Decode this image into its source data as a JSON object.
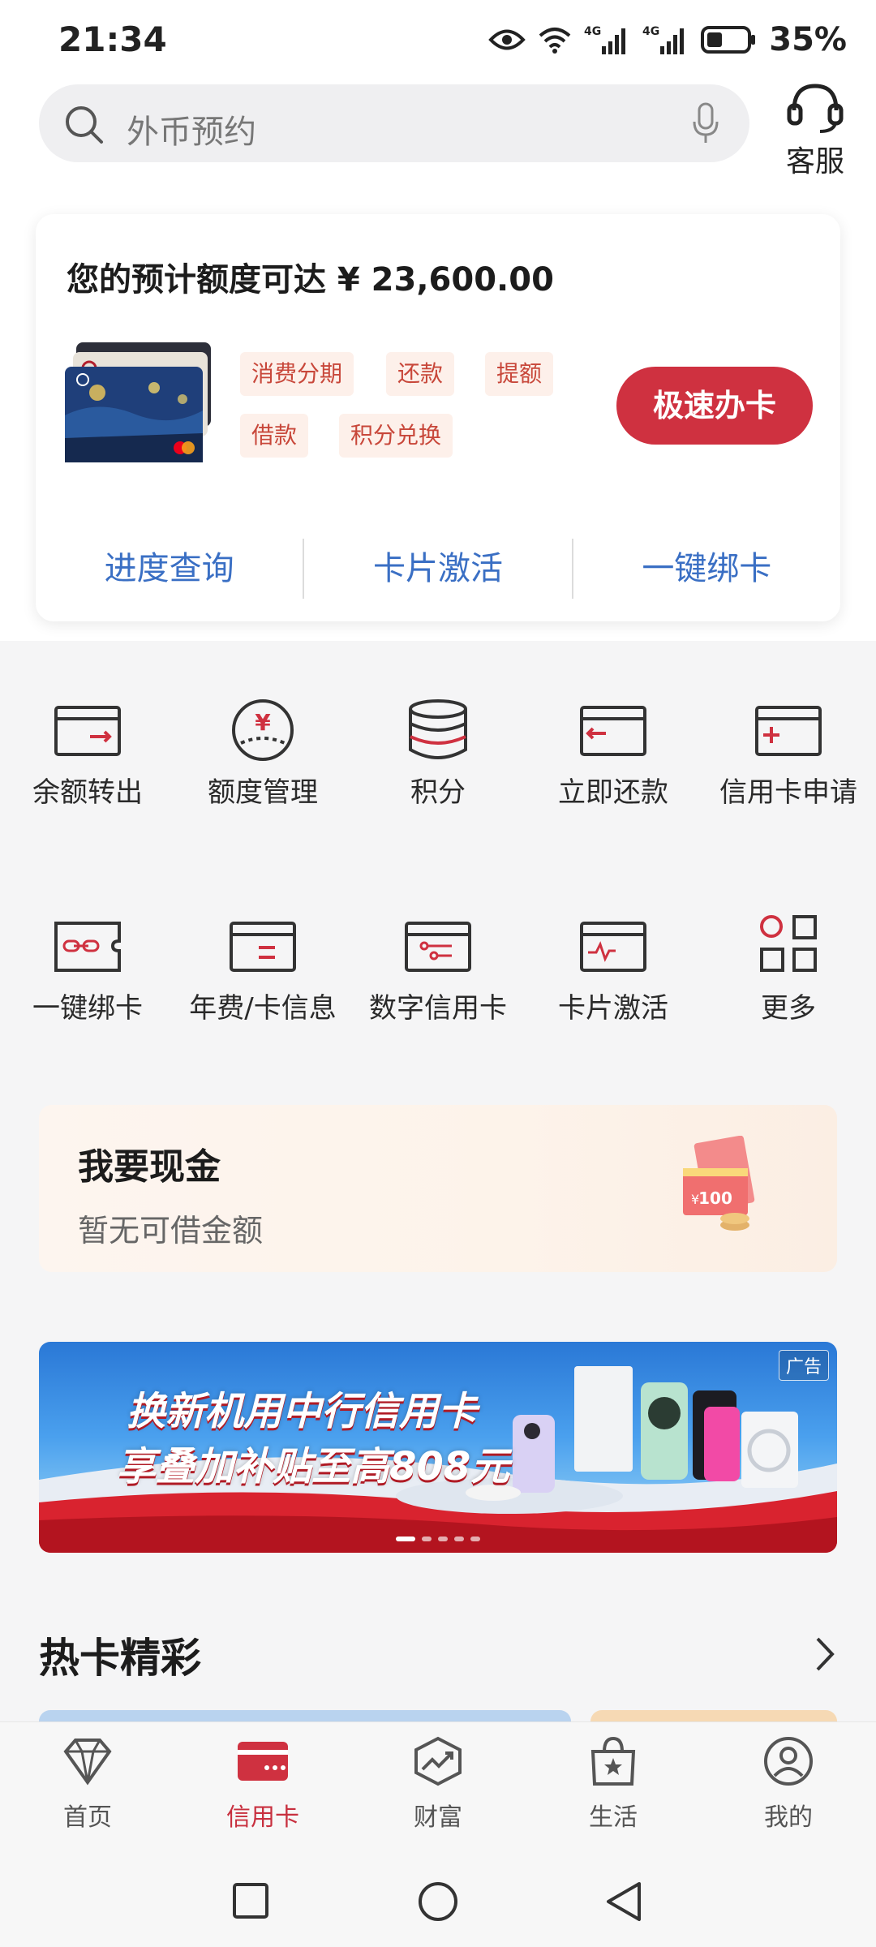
{
  "status": {
    "time": "21:34",
    "battery": "35%",
    "net1": "4G",
    "net2": "4G"
  },
  "search": {
    "placeholder": "外币预约",
    "service_label": "客服"
  },
  "credit": {
    "title": "您的预计额度可达 ¥ 23,600.00",
    "tags": [
      "消费分期",
      "还款",
      "提额",
      "借款",
      "积分兑换"
    ],
    "apply_label": "极速办卡",
    "links": [
      "进度查询",
      "卡片激活",
      "一键绑卡"
    ]
  },
  "grid": {
    "row1": [
      "余额转出",
      "额度管理",
      "积分",
      "立即还款",
      "信用卡申请"
    ],
    "row2": [
      "一键绑卡",
      "年费/卡信息",
      "数字信用卡",
      "卡片激活",
      "更多"
    ]
  },
  "cash": {
    "title": "我要现金",
    "subtitle": "暂无可借金额",
    "note_value": "100"
  },
  "banner": {
    "ad_tag": "广告",
    "line1": "换新机用中行信用卡",
    "line2": "享叠加补贴至高808元"
  },
  "hot": {
    "title": "热卡精彩"
  },
  "tabs": [
    "首页",
    "信用卡",
    "财富",
    "生活",
    "我的"
  ],
  "colors": {
    "brand_red": "#cf3140",
    "link_blue": "#3a6fc4",
    "tag_text": "#c8473a",
    "tag_bg": "#fdf0ea"
  }
}
